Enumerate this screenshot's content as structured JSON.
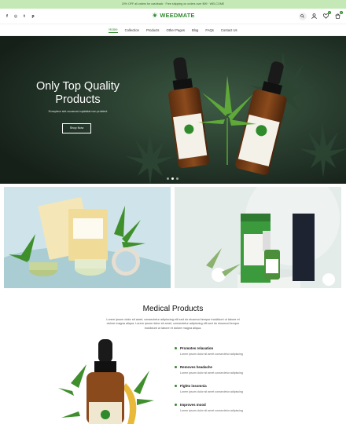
{
  "announcement": "20% OFF all orders for cashback · Free shipping on orders over $99 · WELCOME",
  "brand": {
    "name": "WEEDMATE",
    "accent": "#2f8a2b"
  },
  "socials": [
    {
      "name": "facebook-icon",
      "glyph": "f"
    },
    {
      "name": "instagram-icon",
      "glyph": "◎"
    },
    {
      "name": "twitter-icon",
      "glyph": "t"
    },
    {
      "name": "pinterest-icon",
      "glyph": "p"
    }
  ],
  "cart_count": "0",
  "wishlist_count": "0",
  "nav": [
    "Home",
    "Collection",
    "Products",
    "Other Pages",
    "Blog",
    "FAQs",
    "Contact Us"
  ],
  "hero": {
    "title": "Only Top Quality Products",
    "subtitle": "Excepteur sint occaecat cupidatat non proident",
    "button": "Shop Now",
    "slides": 3,
    "active_slide": 1
  },
  "section": {
    "title": "Medical Products",
    "description": "Lorem ipsum dolor sit amet, consectetur adipiscing elit sed do eiusmod tempor incididunt ut labore et dolore magna aliqua. Lorem ipsum dolor sit amet, consectetur adipiscing elit sed do eiusmod tempor incididunt ut labore et dolore magna aliqua."
  },
  "features": [
    {
      "title": "Promotes relaxation",
      "text": "Lorem ipsum dolor sit amet consectetur adipiscing"
    },
    {
      "title": "Removes headache",
      "text": "Lorem ipsum dolor sit amet consectetur adipiscing"
    },
    {
      "title": "Fights insomnia",
      "text": "Lorem ipsum dolor sit amet consectetur adipiscing"
    },
    {
      "title": "Improves mood",
      "text": "Lorem ipsum dolor sit amet consectetur adipiscing"
    }
  ]
}
